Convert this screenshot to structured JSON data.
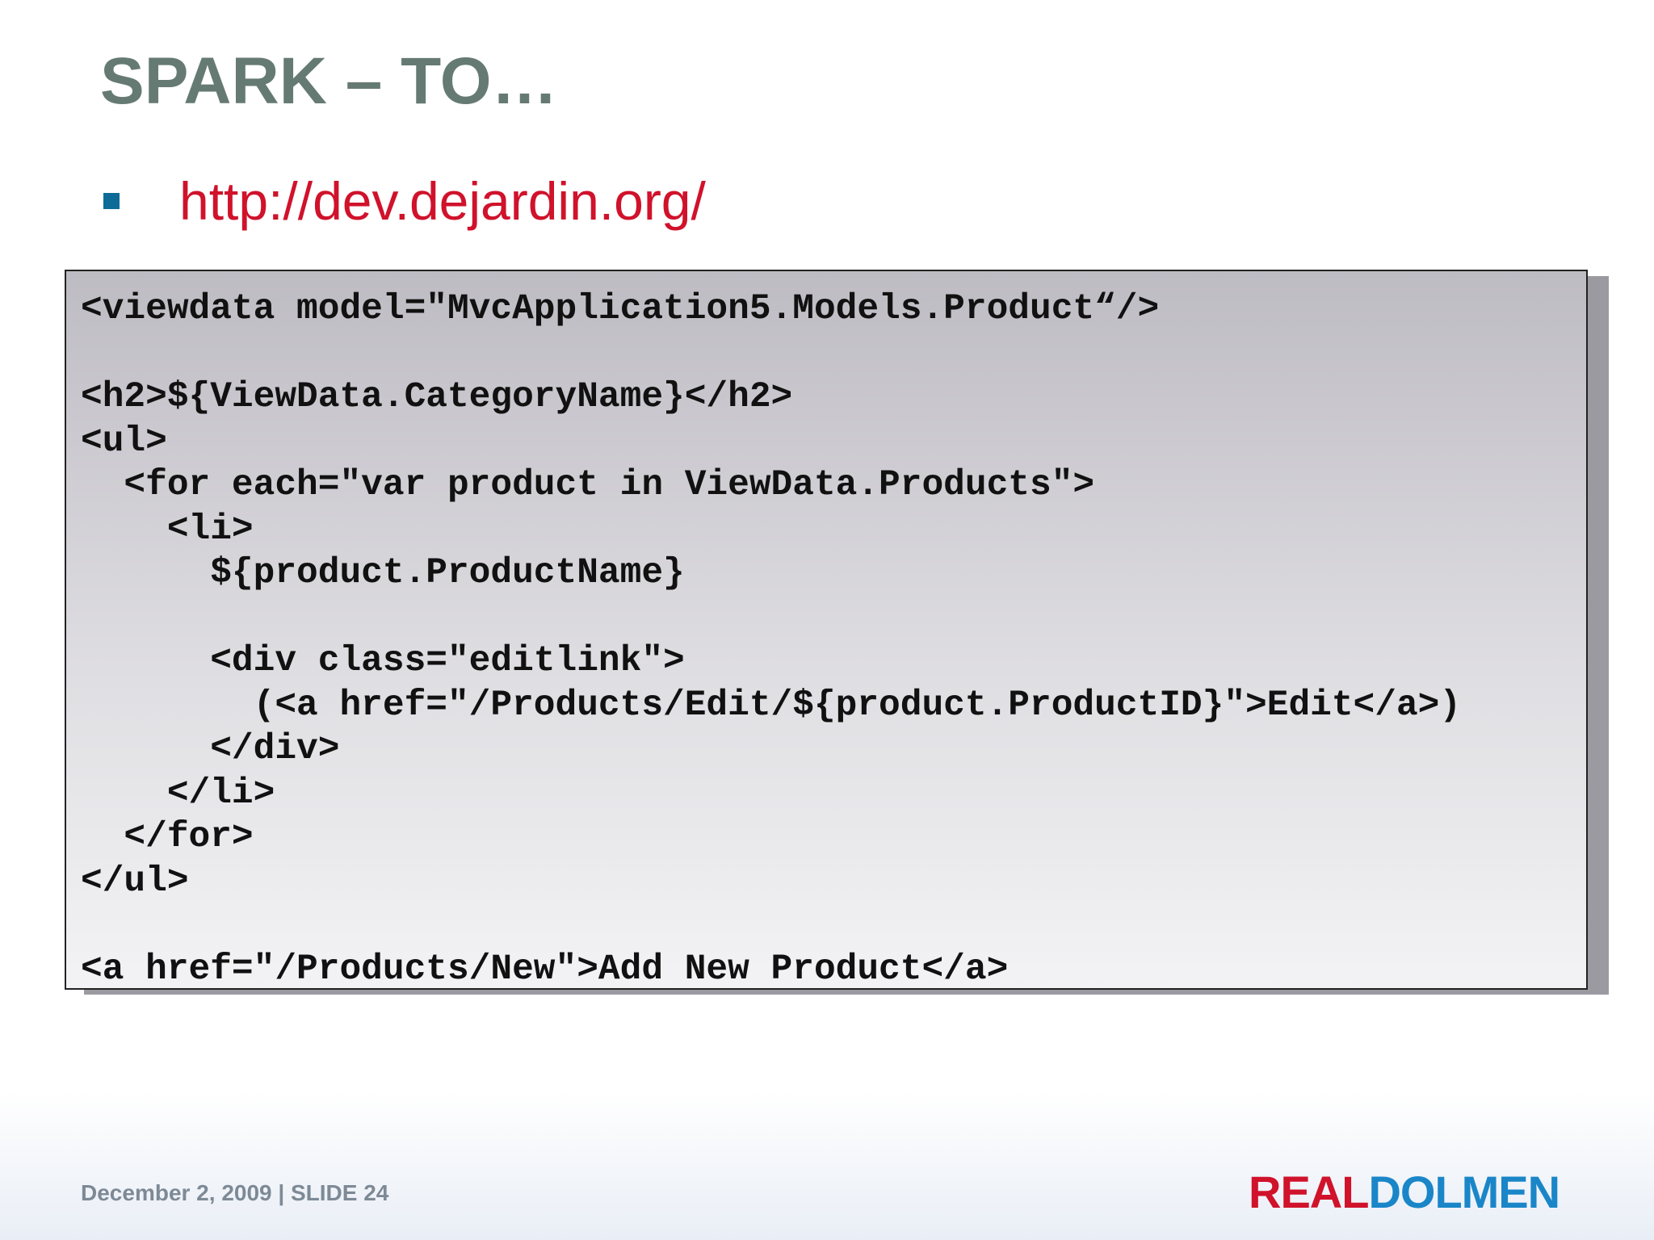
{
  "slide": {
    "title": "SPARK – TO…",
    "bullet_link": "http://dev.dejardin.org/"
  },
  "code": {
    "lines": [
      "<viewdata model=\"MvcApplication5.Models.Product“/>",
      "",
      "<h2>${ViewData.CategoryName}</h2>",
      "<ul>",
      "  <for each=\"var product in ViewData.Products\">",
      "    <li>",
      "      ${product.ProductName}",
      "",
      "      <div class=\"editlink\">",
      "        (<a href=\"/Products/Edit/${product.ProductID}\">Edit</a>)",
      "      </div>",
      "    </li>",
      "  </for>",
      "</ul>",
      "",
      "<a href=\"/Products/New\">Add New Product</a>"
    ]
  },
  "footer": {
    "date_slide": "December 2, 2009 | SLIDE 24",
    "logo_part1": "REAL",
    "logo_part2": "DOLMEN"
  },
  "colors": {
    "title": "#667a74",
    "link": "#d0122b",
    "bullet": "#0e6b98",
    "logo_real": "#d0122b",
    "logo_dolmen": "#1a86c8"
  }
}
